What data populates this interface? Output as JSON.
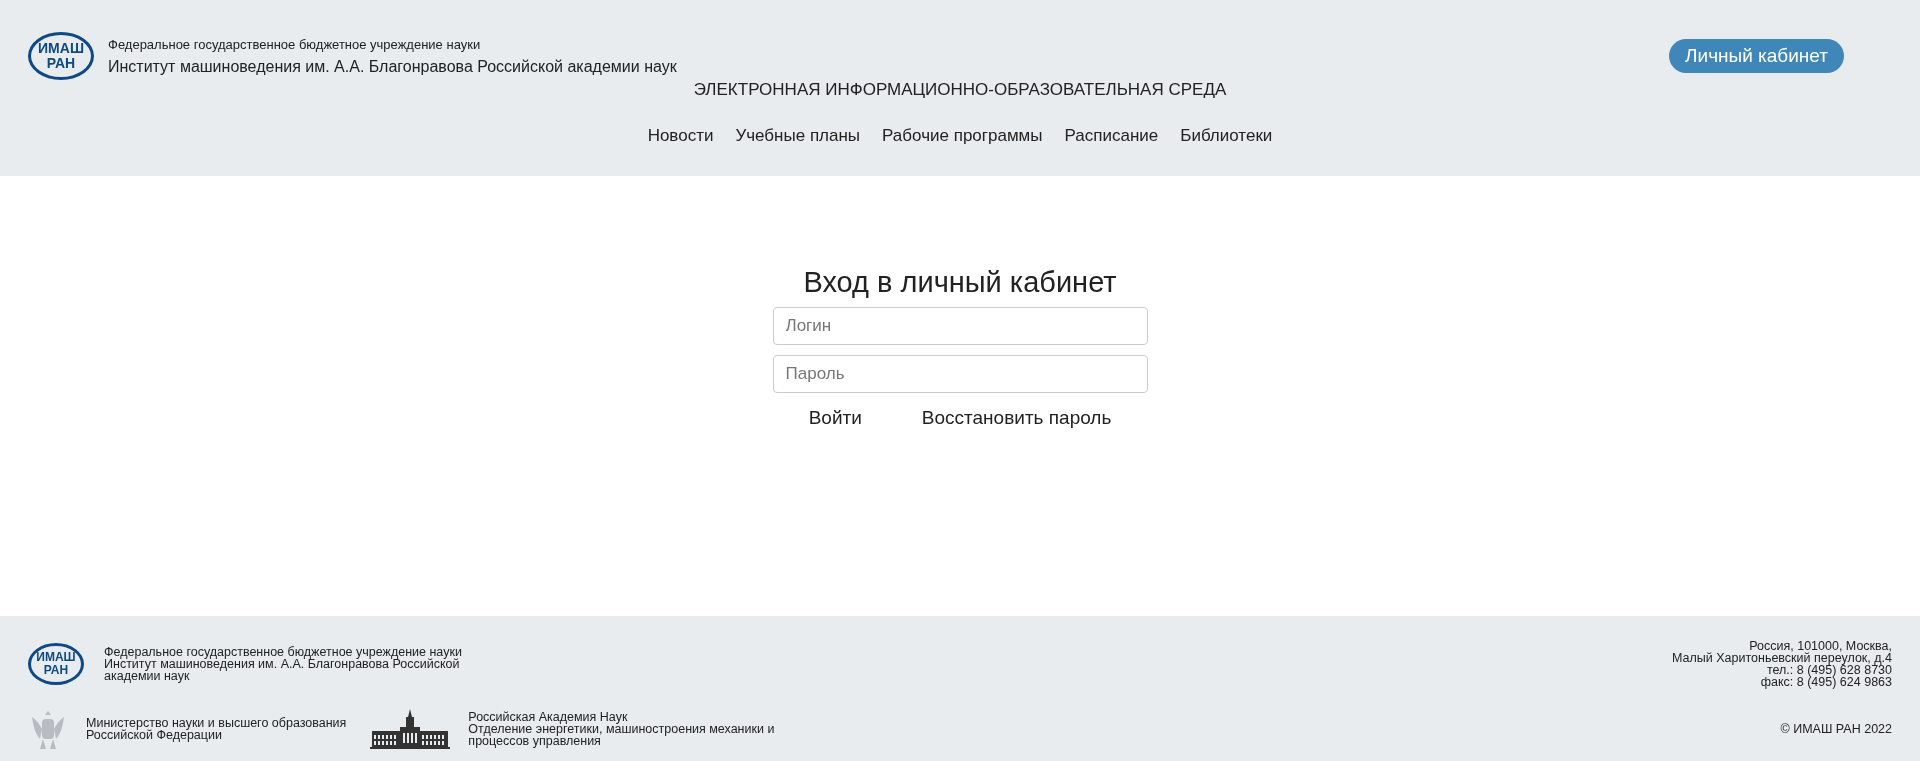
{
  "header": {
    "logo": {
      "line_1": "ИМАШ",
      "line_2": "РАН"
    },
    "org_type": "Федеральное государственное бюджетное учреждение науки",
    "org_name": "Институт машиноведения им. А.А. Благонравова Российской академии наук",
    "cabinet_button": "Личный кабинет",
    "site_title": "ЭЛЕКТРОННАЯ ИНФОРМАЦИОННО-ОБРАЗОВАТЕЛЬНАЯ СРЕДА",
    "nav": [
      "Новости",
      "Учебные планы",
      "Рабочие программы",
      "Расписание",
      "Библиотеки"
    ]
  },
  "login": {
    "title": "Вход в личный кабинет",
    "login_field": {
      "placeholder": "Логин"
    },
    "password_field": {
      "placeholder": "Пароль"
    },
    "submit": "Войти",
    "restore": "Восстановить пароль"
  },
  "footer": {
    "logo": {
      "line_1": "ИМАШ",
      "line_2": "РАН"
    },
    "institute": [
      "Федеральное государственное бюджетное учреждение науки",
      "Институт машиноведения им. А.А. Благонравова Российской",
      "академии наук"
    ],
    "ministry": [
      "Министерство науки и высшего образования",
      "Российской Федерации"
    ],
    "academy": [
      "Российская Академия Наук",
      "Отделение энергетики, машиностроения механики и",
      "процессов управления"
    ],
    "address": [
      "Россия, 101000, Москва,",
      "Малый Харитоньевский переулок, д.4",
      "тел.: 8 (495) 628 8730",
      "факс: 8 (495) 624 9863"
    ],
    "copyright": "© ИМАШ РАН 2022"
  }
}
